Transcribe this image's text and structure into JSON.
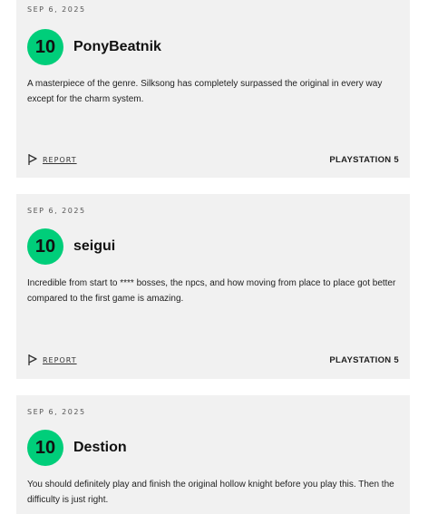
{
  "reviews": [
    {
      "date": "SEP 6, 2025",
      "score": "10",
      "username": "PonyBeatnik",
      "text": "A masterpiece of the genre. Silksong has completely surpassed the original in every way except for the charm system.",
      "report_label": "REPORT",
      "platform": "PLAYSTATION 5"
    },
    {
      "date": "SEP 6, 2025",
      "score": "10",
      "username": "seigui",
      "text": "Incredible from start to **** bosses, the npcs, and how moving from place to place got better compared to the first game is amazing.",
      "report_label": "REPORT",
      "platform": "PLAYSTATION 5"
    },
    {
      "date": "SEP 6, 2025",
      "score": "10",
      "username": "Destion",
      "text": "You should definitely play and finish the original hollow knight before you play this. Then the difficulty is just right.",
      "report_label": "",
      "platform": ""
    }
  ],
  "colors": {
    "score_badge": "#00ce7a",
    "card_background": "#f1f1f1"
  },
  "icons": {
    "report": "flag-icon"
  }
}
